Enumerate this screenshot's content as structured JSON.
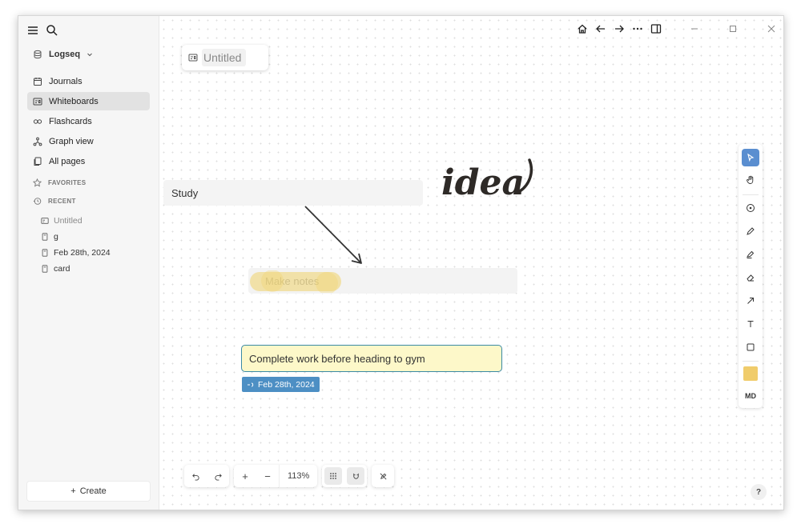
{
  "sidebar": {
    "graph_name": "Logseq",
    "nav": [
      {
        "label": "Journals",
        "icon": "calendar-icon"
      },
      {
        "label": "Whiteboards",
        "icon": "whiteboard-icon",
        "active": true
      },
      {
        "label": "Flashcards",
        "icon": "infinity-icon"
      },
      {
        "label": "Graph view",
        "icon": "graph-icon"
      },
      {
        "label": "All pages",
        "icon": "pages-icon"
      }
    ],
    "favorites_label": "FAVORITES",
    "recent_label": "RECENT",
    "recent": [
      {
        "label": "Untitled",
        "icon": "whiteboard-icon"
      },
      {
        "label": "g",
        "icon": "page-icon"
      },
      {
        "label": "Feb 28th, 2024",
        "icon": "page-icon"
      },
      {
        "label": "card",
        "icon": "page-icon"
      }
    ],
    "create_label": "Create"
  },
  "canvas": {
    "title": "Untitled",
    "blocks": {
      "study": "Study",
      "notes": "Make notes",
      "task": "Complete work before heading to gym",
      "date_tag": "Feb 28th, 2024"
    },
    "handwriting": "idea",
    "zoom": "113%",
    "md_label": "MD",
    "help_label": "?",
    "accent_color": "#5a8ed0",
    "swatch_color": "#f0cc6b"
  }
}
